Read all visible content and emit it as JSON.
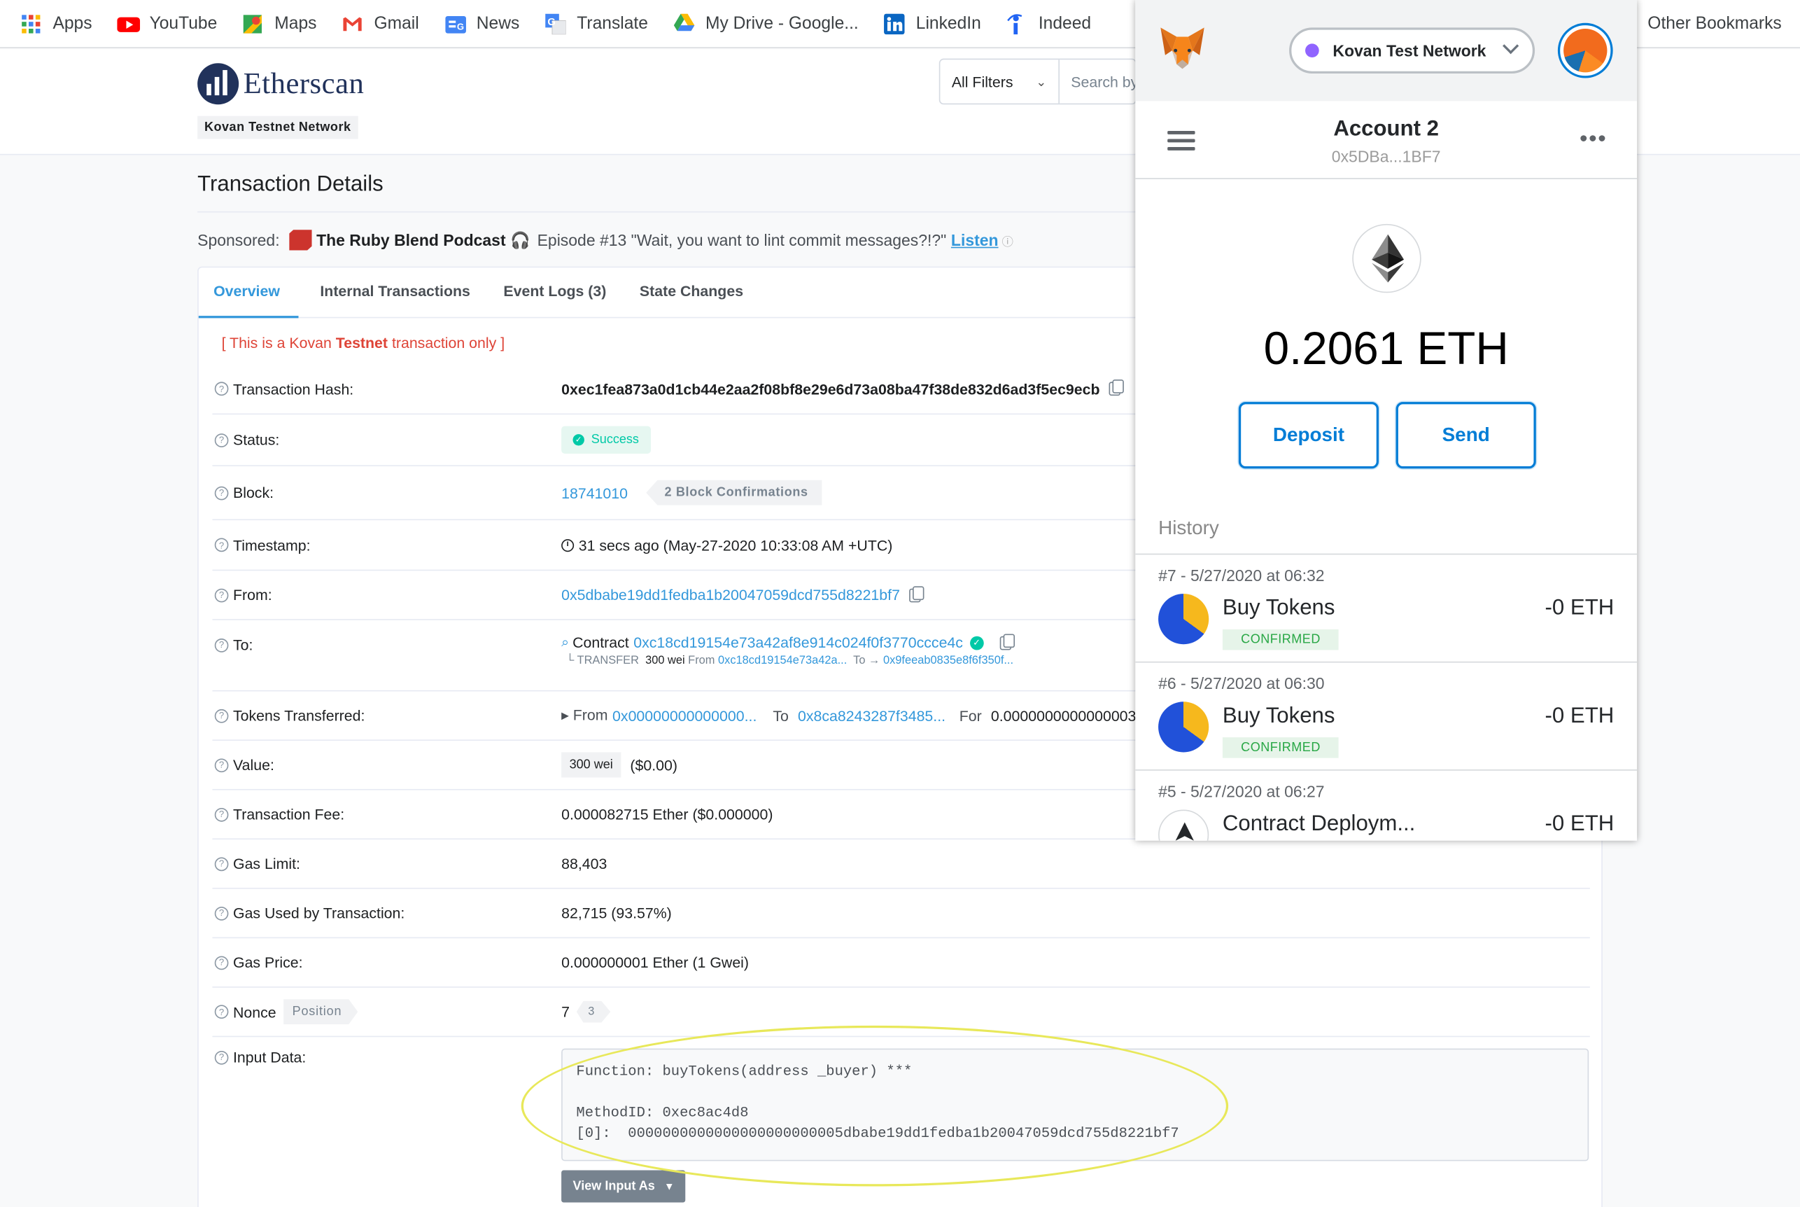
{
  "bookmarks": {
    "items": [
      {
        "label": "Apps",
        "icon": "apps-grid-icon"
      },
      {
        "label": "YouTube",
        "icon": "youtube-icon"
      },
      {
        "label": "Maps",
        "icon": "maps-icon"
      },
      {
        "label": "Gmail",
        "icon": "gmail-icon"
      },
      {
        "label": "News",
        "icon": "news-icon"
      },
      {
        "label": "Translate",
        "icon": "translate-icon"
      },
      {
        "label": "My Drive - Google...",
        "icon": "drive-icon"
      },
      {
        "label": "LinkedIn",
        "icon": "linkedin-icon"
      },
      {
        "label": "Indeed",
        "icon": "indeed-icon"
      }
    ],
    "other": "Other Bookmarks"
  },
  "etherscan": {
    "logo_text": "Etherscan",
    "network_badge": "Kovan Testnet Network",
    "filter_label": "All Filters",
    "search_placeholder": "Search by"
  },
  "page": {
    "title": "Transaction Details",
    "sponsored_label": "Sponsored:",
    "sponsor_name": "The Ruby Blend Podcast",
    "sponsor_text": "Episode #13 \"Wait, you want to lint commit messages?!?\"",
    "sponsor_link": "Listen",
    "tabs": [
      "Overview",
      "Internal Transactions",
      "Event Logs (3)",
      "State Changes"
    ],
    "testnet_note_pre": "[ This is a Kovan ",
    "testnet_note_bold": "Testnet",
    "testnet_note_post": " transaction only ]"
  },
  "details": {
    "hash_label": "Transaction Hash:",
    "hash": "0xec1fea873a0d1cb44e2aa2f08bf8e29e6d73a08ba47f38de832d6ad3f5ec9ecb",
    "status_label": "Status:",
    "status": "Success",
    "block_label": "Block:",
    "block": "18741010",
    "confirmations": "2 Block Confirmations",
    "timestamp_label": "Timestamp:",
    "timestamp": "31 secs ago (May-27-2020 10:33:08 AM +UTC)",
    "from_label": "From:",
    "from": "0x5dbabe19dd1fedba1b20047059dcd755d8221bf7",
    "to_label": "To:",
    "to_prefix": "Contract",
    "to": "0xc18cd19154e73a42af8e914c024f0f3770ccce4c",
    "transfer_prefix": "└ TRANSFER",
    "transfer_amount": "300 wei",
    "transfer_from_label": "From",
    "transfer_from": "0xc18cd19154e73a42a...",
    "transfer_to_label": "To →",
    "transfer_to": "0x9feeab0835e8f6f350f...",
    "tokens_label": "Tokens Transferred:",
    "tokens_from_label": "▸ From",
    "tokens_from": "0x00000000000000...",
    "tokens_to_label": "To",
    "tokens_to": "0x8ca8243287f3485...",
    "tokens_for_label": "For",
    "tokens_for": "0.0000000000000003",
    "value_label": "Value:",
    "value_wei": "300 wei",
    "value_usd": "($0.00)",
    "fee_label": "Transaction Fee:",
    "fee": "0.000082715 Ether ($0.000000)",
    "gas_limit_label": "Gas Limit:",
    "gas_limit": "88,403",
    "gas_used_label": "Gas Used by Transaction:",
    "gas_used": "82,715 (93.57%)",
    "gas_price_label": "Gas Price:",
    "gas_price": "0.000000001 Ether (1 Gwei)",
    "nonce_label": "Nonce",
    "position_label": "Position",
    "nonce": "7",
    "position": "3",
    "input_label": "Input Data:",
    "input_data": "Function: buyTokens(address _buyer) ***\n\nMethodID: 0xec8ac4d8\n[0]:  0000000000000000000000005dbabe19dd1fedba1b20047059dcd755d8221bf7",
    "view_input_button": "View Input As"
  },
  "metamask": {
    "network": "Kovan Test Network",
    "account_name": "Account 2",
    "account_address": "0x5DBa...1BF7",
    "balance": "0.2061 ETH",
    "deposit_label": "Deposit",
    "send_label": "Send",
    "history_label": "History",
    "transactions": [
      {
        "date": "#7 - 5/27/2020 at 06:32",
        "title": "Buy Tokens",
        "status": "CONFIRMED",
        "amount": "-0 ETH"
      },
      {
        "date": "#6 - 5/27/2020 at 06:30",
        "title": "Buy Tokens",
        "status": "CONFIRMED",
        "amount": "-0 ETH"
      },
      {
        "date": "#5 - 5/27/2020 at 06:27",
        "title": "Contract Deploym...",
        "status": "",
        "amount": "-0 ETH"
      }
    ],
    "accent_color": "#037dd6"
  }
}
